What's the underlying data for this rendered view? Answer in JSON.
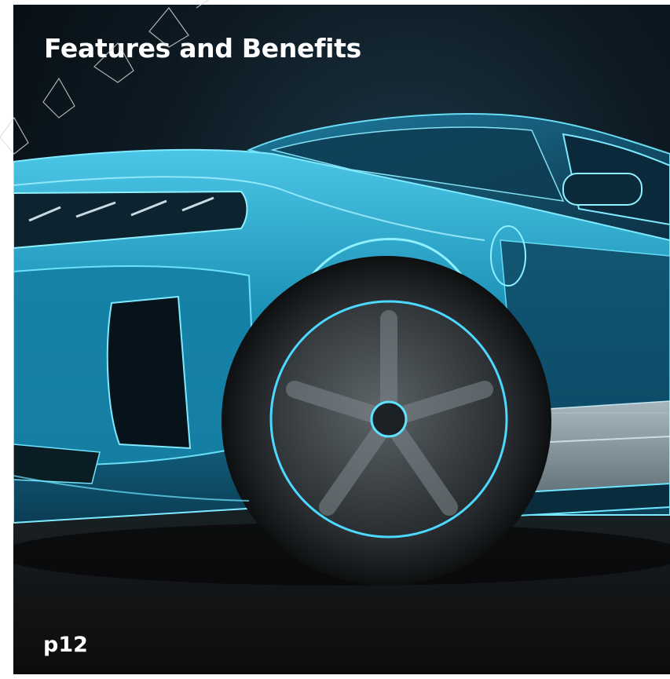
{
  "header": {
    "title": "Features and Benefits"
  },
  "footer": {
    "page_ref": "p12"
  },
  "image": {
    "subject": "car-xray-render",
    "colors": {
      "body_cyan": "#1fa9cf",
      "outline_glow": "#6fe6ff",
      "background_dark": "#070d12",
      "title_text": "#ffffff"
    }
  }
}
